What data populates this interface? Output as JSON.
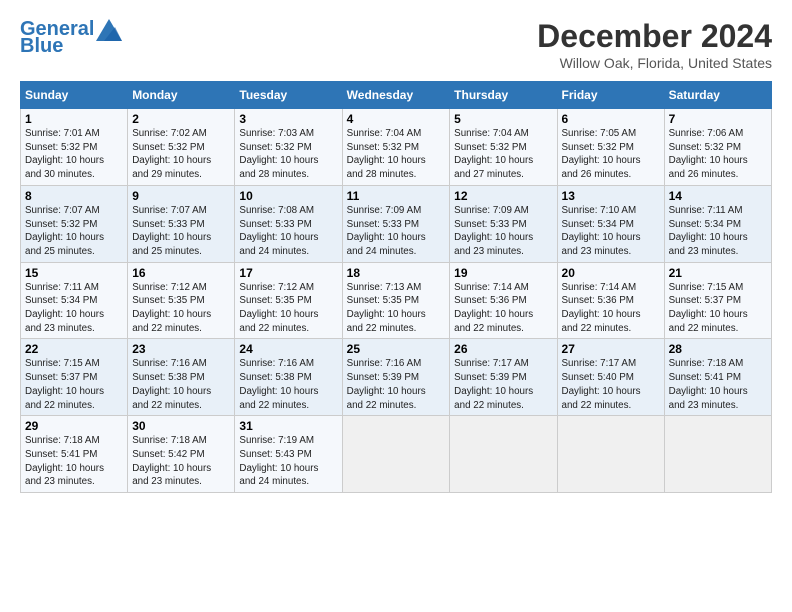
{
  "header": {
    "logo_line1": "General",
    "logo_line2": "Blue",
    "title": "December 2024",
    "subtitle": "Willow Oak, Florida, United States"
  },
  "calendar": {
    "headers": [
      "Sunday",
      "Monday",
      "Tuesday",
      "Wednesday",
      "Thursday",
      "Friday",
      "Saturday"
    ],
    "weeks": [
      [
        {
          "day": "1",
          "info": "Sunrise: 7:01 AM\nSunset: 5:32 PM\nDaylight: 10 hours\nand 30 minutes."
        },
        {
          "day": "2",
          "info": "Sunrise: 7:02 AM\nSunset: 5:32 PM\nDaylight: 10 hours\nand 29 minutes."
        },
        {
          "day": "3",
          "info": "Sunrise: 7:03 AM\nSunset: 5:32 PM\nDaylight: 10 hours\nand 28 minutes."
        },
        {
          "day": "4",
          "info": "Sunrise: 7:04 AM\nSunset: 5:32 PM\nDaylight: 10 hours\nand 28 minutes."
        },
        {
          "day": "5",
          "info": "Sunrise: 7:04 AM\nSunset: 5:32 PM\nDaylight: 10 hours\nand 27 minutes."
        },
        {
          "day": "6",
          "info": "Sunrise: 7:05 AM\nSunset: 5:32 PM\nDaylight: 10 hours\nand 26 minutes."
        },
        {
          "day": "7",
          "info": "Sunrise: 7:06 AM\nSunset: 5:32 PM\nDaylight: 10 hours\nand 26 minutes."
        }
      ],
      [
        {
          "day": "8",
          "info": "Sunrise: 7:07 AM\nSunset: 5:32 PM\nDaylight: 10 hours\nand 25 minutes."
        },
        {
          "day": "9",
          "info": "Sunrise: 7:07 AM\nSunset: 5:33 PM\nDaylight: 10 hours\nand 25 minutes."
        },
        {
          "day": "10",
          "info": "Sunrise: 7:08 AM\nSunset: 5:33 PM\nDaylight: 10 hours\nand 24 minutes."
        },
        {
          "day": "11",
          "info": "Sunrise: 7:09 AM\nSunset: 5:33 PM\nDaylight: 10 hours\nand 24 minutes."
        },
        {
          "day": "12",
          "info": "Sunrise: 7:09 AM\nSunset: 5:33 PM\nDaylight: 10 hours\nand 23 minutes."
        },
        {
          "day": "13",
          "info": "Sunrise: 7:10 AM\nSunset: 5:34 PM\nDaylight: 10 hours\nand 23 minutes."
        },
        {
          "day": "14",
          "info": "Sunrise: 7:11 AM\nSunset: 5:34 PM\nDaylight: 10 hours\nand 23 minutes."
        }
      ],
      [
        {
          "day": "15",
          "info": "Sunrise: 7:11 AM\nSunset: 5:34 PM\nDaylight: 10 hours\nand 23 minutes."
        },
        {
          "day": "16",
          "info": "Sunrise: 7:12 AM\nSunset: 5:35 PM\nDaylight: 10 hours\nand 22 minutes."
        },
        {
          "day": "17",
          "info": "Sunrise: 7:12 AM\nSunset: 5:35 PM\nDaylight: 10 hours\nand 22 minutes."
        },
        {
          "day": "18",
          "info": "Sunrise: 7:13 AM\nSunset: 5:35 PM\nDaylight: 10 hours\nand 22 minutes."
        },
        {
          "day": "19",
          "info": "Sunrise: 7:14 AM\nSunset: 5:36 PM\nDaylight: 10 hours\nand 22 minutes."
        },
        {
          "day": "20",
          "info": "Sunrise: 7:14 AM\nSunset: 5:36 PM\nDaylight: 10 hours\nand 22 minutes."
        },
        {
          "day": "21",
          "info": "Sunrise: 7:15 AM\nSunset: 5:37 PM\nDaylight: 10 hours\nand 22 minutes."
        }
      ],
      [
        {
          "day": "22",
          "info": "Sunrise: 7:15 AM\nSunset: 5:37 PM\nDaylight: 10 hours\nand 22 minutes."
        },
        {
          "day": "23",
          "info": "Sunrise: 7:16 AM\nSunset: 5:38 PM\nDaylight: 10 hours\nand 22 minutes."
        },
        {
          "day": "24",
          "info": "Sunrise: 7:16 AM\nSunset: 5:38 PM\nDaylight: 10 hours\nand 22 minutes."
        },
        {
          "day": "25",
          "info": "Sunrise: 7:16 AM\nSunset: 5:39 PM\nDaylight: 10 hours\nand 22 minutes."
        },
        {
          "day": "26",
          "info": "Sunrise: 7:17 AM\nSunset: 5:39 PM\nDaylight: 10 hours\nand 22 minutes."
        },
        {
          "day": "27",
          "info": "Sunrise: 7:17 AM\nSunset: 5:40 PM\nDaylight: 10 hours\nand 22 minutes."
        },
        {
          "day": "28",
          "info": "Sunrise: 7:18 AM\nSunset: 5:41 PM\nDaylight: 10 hours\nand 23 minutes."
        }
      ],
      [
        {
          "day": "29",
          "info": "Sunrise: 7:18 AM\nSunset: 5:41 PM\nDaylight: 10 hours\nand 23 minutes."
        },
        {
          "day": "30",
          "info": "Sunrise: 7:18 AM\nSunset: 5:42 PM\nDaylight: 10 hours\nand 23 minutes."
        },
        {
          "day": "31",
          "info": "Sunrise: 7:19 AM\nSunset: 5:43 PM\nDaylight: 10 hours\nand 24 minutes."
        },
        {
          "day": "",
          "info": ""
        },
        {
          "day": "",
          "info": ""
        },
        {
          "day": "",
          "info": ""
        },
        {
          "day": "",
          "info": ""
        }
      ]
    ]
  }
}
